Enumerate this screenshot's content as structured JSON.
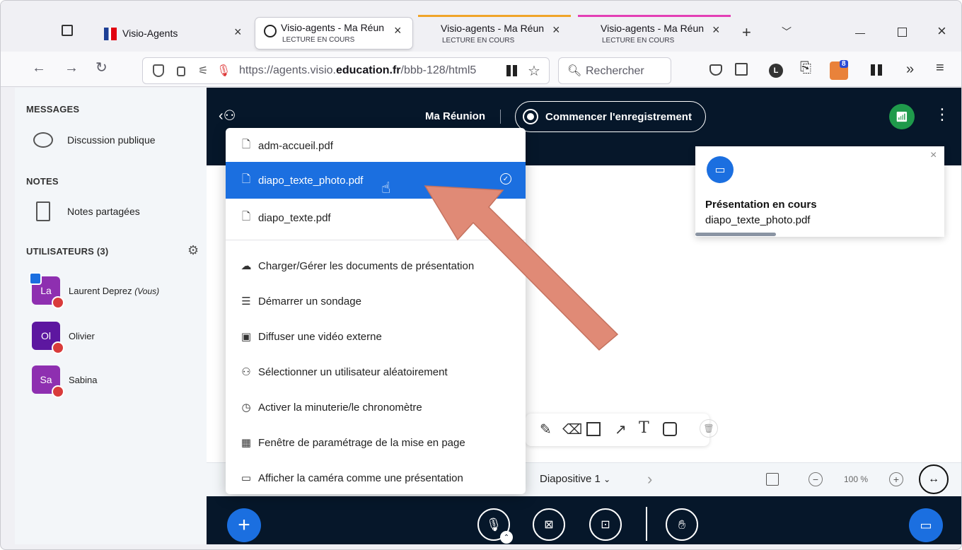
{
  "browser": {
    "tabs": [
      {
        "title": "Visio-Agents",
        "subtitle": ""
      },
      {
        "title": "Visio-agents - Ma Réun",
        "subtitle": "LECTURE EN COURS"
      },
      {
        "title": "Visio-agents - Ma Réun",
        "subtitle": "LECTURE EN COURS"
      },
      {
        "title": "Visio-agents - Ma Réun",
        "subtitle": "LECTURE EN COURS"
      }
    ],
    "url_prefix": "https://agents.visio.",
    "url_domain": "education.fr",
    "url_path": "/bbb-128/html5",
    "search_placeholder": "Rechercher",
    "ext_badge": "8",
    "profile_letter": "L"
  },
  "sidebar": {
    "messages_heading": "MESSAGES",
    "public_chat": "Discussion publique",
    "notes_heading": "NOTES",
    "shared_notes": "Notes partagées",
    "users_heading": "UTILISATEURS (3)",
    "users": [
      {
        "initials": "La",
        "name": "Laurent Deprez",
        "suffix": "(Vous)",
        "color": "#8e2fb0"
      },
      {
        "initials": "Ol",
        "name": "Olivier",
        "suffix": "",
        "color": "#5d17a0"
      },
      {
        "initials": "Sa",
        "name": "Sabina",
        "suffix": "",
        "color": "#8e2fb0"
      }
    ]
  },
  "topbar": {
    "meeting_title": "Ma Réunion",
    "record_label": "Commencer l'enregistrement"
  },
  "menu": {
    "files": [
      "adm-accueil.pdf",
      "diapo_texte_photo.pdf",
      "diapo_texte.pdf"
    ],
    "selected_index": 1,
    "actions": [
      "Charger/Gérer les documents de présentation",
      "Démarrer un sondage",
      "Diffuser une vidéo externe",
      "Sélectionner un utilisateur aléatoirement",
      "Activer la minuterie/le chronomètre",
      "Fenêtre de paramétrage de la mise en page",
      "Afficher la caméra comme une présentation"
    ]
  },
  "toast": {
    "title": "Présentation en cours",
    "file": "diapo_texte_photo.pdf"
  },
  "slidebar": {
    "slide_label": "Diapositive 1",
    "zoom": "100 %"
  },
  "colors": {
    "accent": "#1b6fe0",
    "dark_bar": "#06172a",
    "arrow": "#e08a76",
    "connection": "#1f9a4b"
  }
}
